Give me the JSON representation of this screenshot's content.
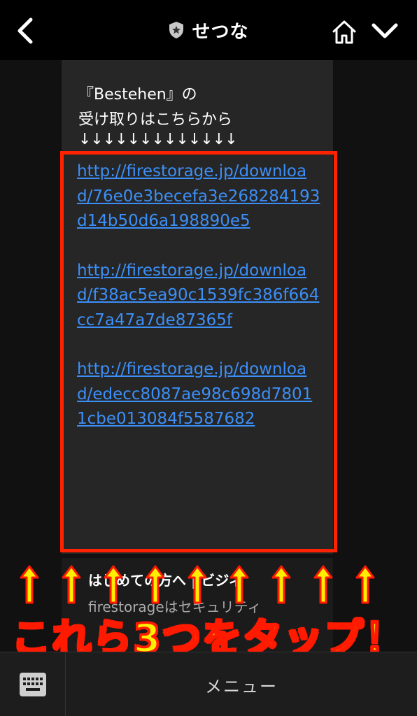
{
  "header": {
    "title": "せつな",
    "back_icon": "chevron-left-icon",
    "home_icon": "home-icon",
    "menu_icon": "chevron-down-icon",
    "badge_icon": "shield-star-icon"
  },
  "message": {
    "line1": "『Bestehen』の",
    "line2": "受け取りはこちらから",
    "arrows": "↓↓↓↓↓↓↓↓↓↓↓↓↓",
    "links": [
      "http://firestorage.jp/download/76e0e3becefa3e268284193d14b50d6a198890e5",
      "http://firestorage.jp/download/f38ac5ea90c1539fc386f664cc7a47a7de87365f",
      "http://firestorage.jp/download/edecc8087ae98c698d78011cbe013084f5587682"
    ]
  },
  "next_message": {
    "title": "はじめての方へ | ビジネ",
    "text": "firestorageはセキュリティ"
  },
  "overlay": {
    "caption": "これら3つをタップ！",
    "caption_color": "#ffee00",
    "outline_color": "#ff1a00"
  },
  "bottom_bar": {
    "keyboard_icon": "keyboard-icon",
    "menu_label": "メニュー"
  }
}
